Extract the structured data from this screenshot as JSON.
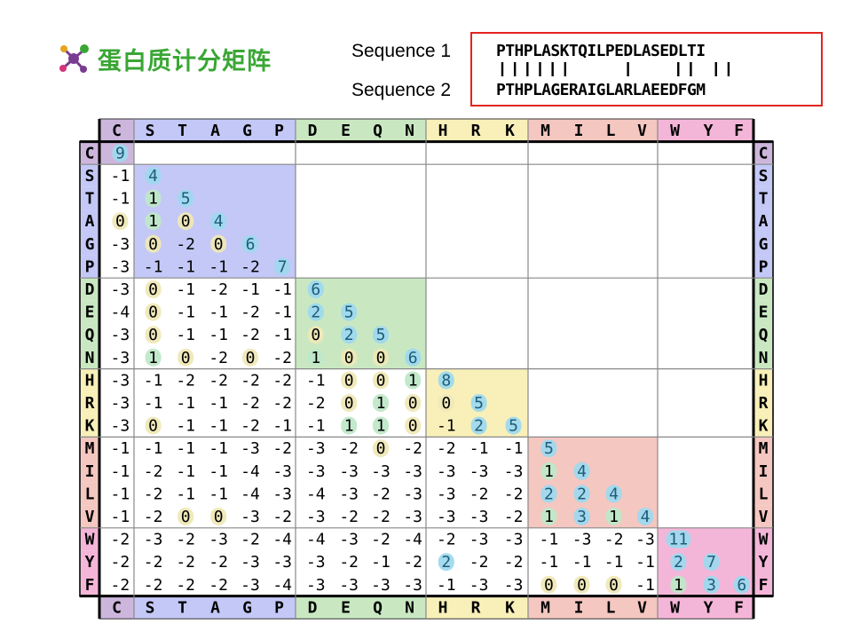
{
  "title": "蛋白质计分矩阵",
  "icon": "molecule-icon",
  "sequence1_label": "Sequence 1",
  "sequence2_label": "Sequence 2",
  "sequence1": "PTHPLASKTQILPEDLASEDLTI",
  "sequence2": "PTHPLAGERAIGLARLAEEDFGM",
  "alignment_bars": "||||||    |   || ||",
  "colors": {
    "title_green": "#3aa635",
    "border_red": "#e32420",
    "group_C": "#cdb6dc",
    "group_STAGP": "#c3c8f7",
    "group_DEQN": "#c9e8c2",
    "group_HRK": "#f8f0b8",
    "group_MILV": "#f5c7c1",
    "group_WYF": "#f4b6d8",
    "score_positive": "#9fd9ee",
    "score_zero": "#efe8b7",
    "score_one": "#bfe8c8"
  },
  "matrix": {
    "amino_acids": [
      "C",
      "S",
      "T",
      "A",
      "G",
      "P",
      "D",
      "E",
      "Q",
      "N",
      "H",
      "R",
      "K",
      "M",
      "I",
      "L",
      "V",
      "W",
      "Y",
      "F"
    ],
    "groups": [
      {
        "name": "C",
        "members": [
          "C"
        ]
      },
      {
        "name": "STAGP",
        "members": [
          "S",
          "T",
          "A",
          "G",
          "P"
        ]
      },
      {
        "name": "DEQN",
        "members": [
          "D",
          "E",
          "Q",
          "N"
        ]
      },
      {
        "name": "HRK",
        "members": [
          "H",
          "R",
          "K"
        ]
      },
      {
        "name": "MILV",
        "members": [
          "M",
          "I",
          "L",
          "V"
        ]
      },
      {
        "name": "WYF",
        "members": [
          "W",
          "Y",
          "F"
        ]
      }
    ],
    "scores": [
      [
        9
      ],
      [
        -1,
        4
      ],
      [
        -1,
        1,
        5
      ],
      [
        0,
        1,
        0,
        4
      ],
      [
        -3,
        0,
        -2,
        0,
        6
      ],
      [
        -3,
        -1,
        -1,
        -1,
        -2,
        7
      ],
      [
        -3,
        0,
        -1,
        -2,
        -1,
        -1,
        6
      ],
      [
        -4,
        0,
        -1,
        -1,
        -2,
        -1,
        2,
        5
      ],
      [
        -3,
        0,
        -1,
        -1,
        -2,
        -1,
        0,
        2,
        5
      ],
      [
        -3,
        1,
        0,
        -2,
        0,
        -2,
        1,
        0,
        0,
        6
      ],
      [
        -3,
        -1,
        -2,
        -2,
        -2,
        -2,
        -1,
        0,
        0,
        1,
        8
      ],
      [
        -3,
        -1,
        -1,
        -1,
        -2,
        -2,
        -2,
        0,
        1,
        0,
        0,
        5
      ],
      [
        -3,
        0,
        -1,
        -1,
        -2,
        -1,
        -1,
        1,
        1,
        0,
        -1,
        2,
        5
      ],
      [
        -1,
        -1,
        -1,
        -1,
        -3,
        -2,
        -3,
        -2,
        0,
        -2,
        -2,
        -1,
        -1,
        5
      ],
      [
        -1,
        -2,
        -1,
        -1,
        -4,
        -3,
        -3,
        -3,
        -3,
        -3,
        -3,
        -3,
        -3,
        1,
        4
      ],
      [
        -1,
        -2,
        -1,
        -1,
        -4,
        -3,
        -4,
        -3,
        -2,
        -3,
        -3,
        -2,
        -2,
        2,
        2,
        4
      ],
      [
        -1,
        -2,
        0,
        0,
        -3,
        -2,
        -3,
        -2,
        -2,
        -3,
        -3,
        -3,
        -2,
        1,
        3,
        1,
        4
      ],
      [
        -2,
        -3,
        -2,
        -3,
        -2,
        -4,
        -4,
        -3,
        -2,
        -4,
        -2,
        -3,
        -3,
        -1,
        -3,
        -2,
        -3,
        11
      ],
      [
        -2,
        -2,
        -2,
        -2,
        -3,
        -3,
        -3,
        -2,
        -1,
        -2,
        2,
        -2,
        -2,
        -1,
        -1,
        -1,
        -1,
        2,
        7
      ],
      [
        -2,
        -2,
        -2,
        -2,
        -3,
        -4,
        -3,
        -3,
        -3,
        -3,
        -1,
        -3,
        -3,
        0,
        0,
        0,
        -1,
        1,
        3,
        6
      ]
    ]
  }
}
